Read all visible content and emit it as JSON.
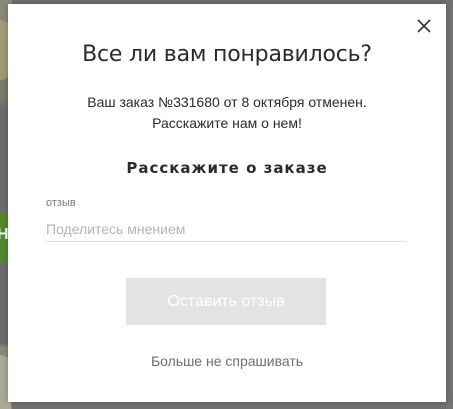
{
  "background": {
    "cta_fragment": "На"
  },
  "modal": {
    "title": "Все ли вам понравилось?",
    "message_line1": "Ваш заказ №331680 от 8 октября отменен.",
    "message_line2": "Расскажите нам о нем!",
    "section_heading": "Расскажите о заказе",
    "field_label": "отзыв",
    "input_value": "",
    "input_placeholder": "Поделитесь мнением",
    "submit_label": "Оставить отзыв",
    "dont_ask_label": "Больше не спрашивать",
    "close_icon": "close-icon"
  },
  "colors": {
    "background_green": "#4f8a2e",
    "text_primary": "#2b2b2b",
    "text_muted": "#6e6e6e",
    "button_disabled_bg": "#e3e3e3",
    "button_disabled_text": "#ffffff"
  }
}
